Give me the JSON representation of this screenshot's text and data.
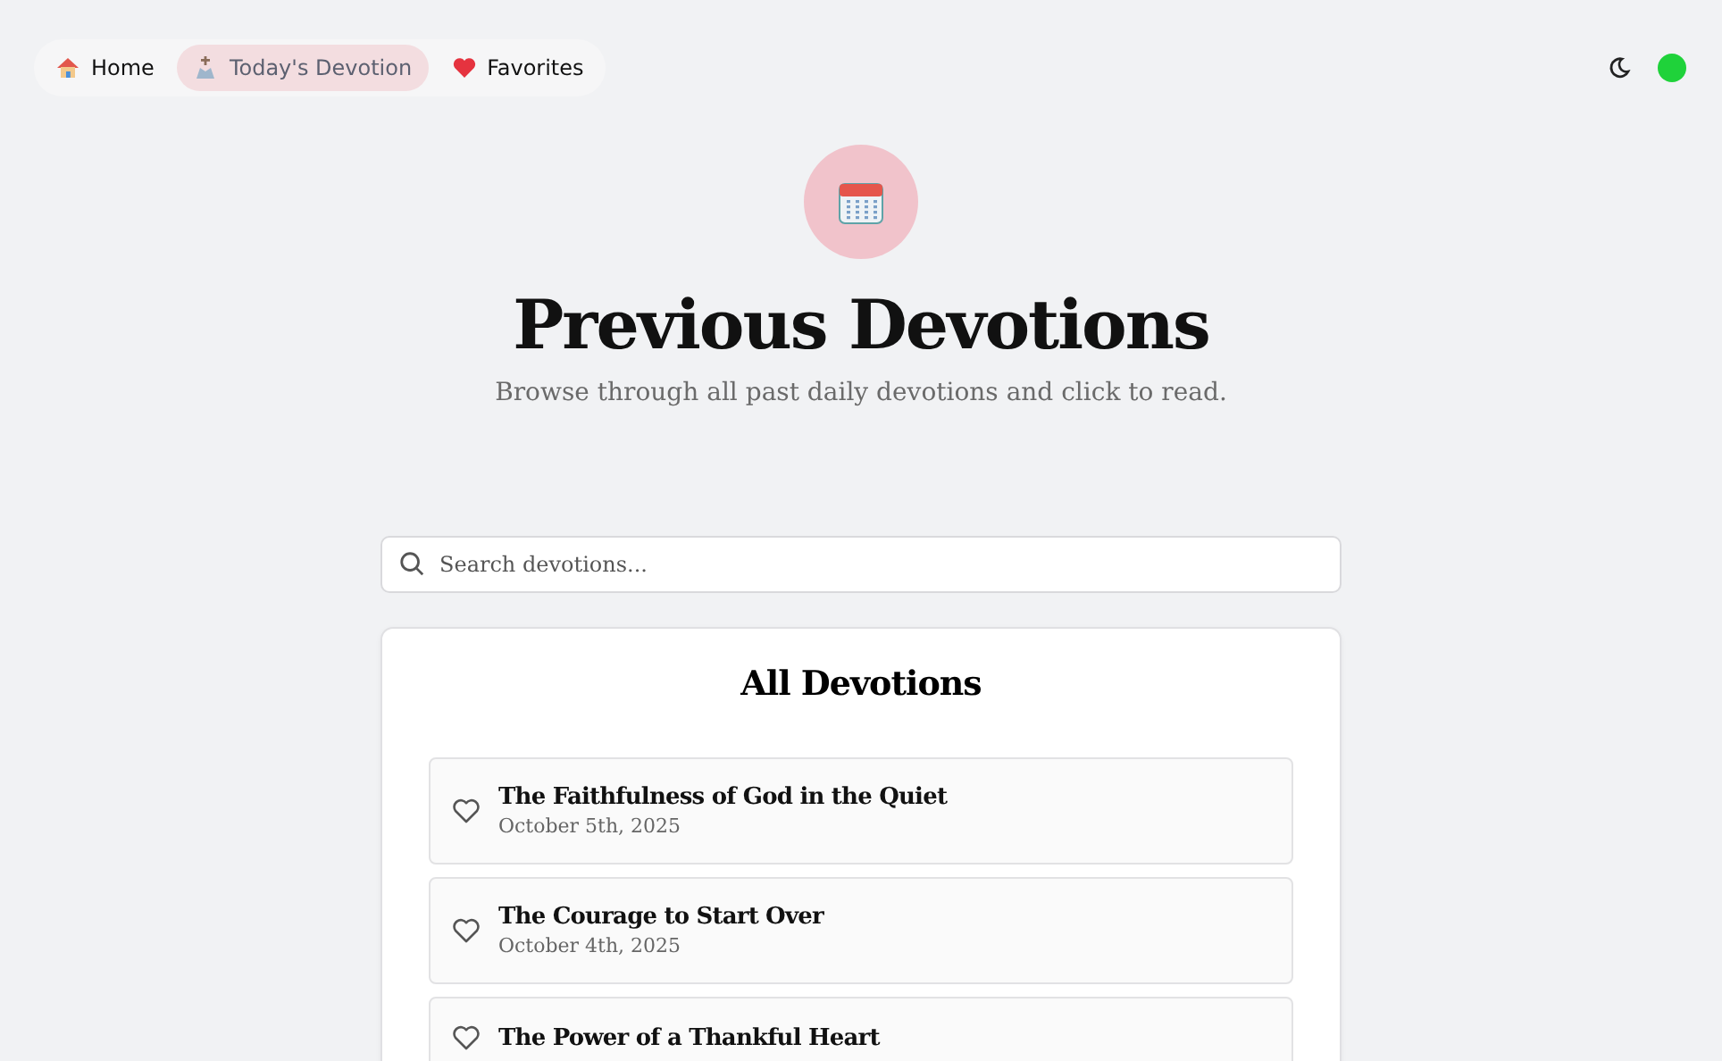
{
  "nav": {
    "tabs": [
      {
        "label": "Home",
        "kind": "home",
        "selected": false
      },
      {
        "label": "Today's Devotion",
        "kind": "devotion",
        "selected": true
      },
      {
        "label": "Favorites",
        "kind": "favorites",
        "selected": false
      }
    ]
  },
  "header": {
    "title": "Previous Devotions",
    "subtitle": "Browse through all past daily devotions and click to read."
  },
  "search": {
    "placeholder": "Search devotions..."
  },
  "list": {
    "title": "All Devotions",
    "items": [
      {
        "title": "The Faithfulness of God in the Quiet",
        "date": "October 5th, 2025",
        "favorite": false
      },
      {
        "title": "The Courage to Start Over",
        "date": "October 4th, 2025",
        "favorite": false
      },
      {
        "title": "The Power of a Thankful Heart",
        "favorite": false
      }
    ]
  }
}
